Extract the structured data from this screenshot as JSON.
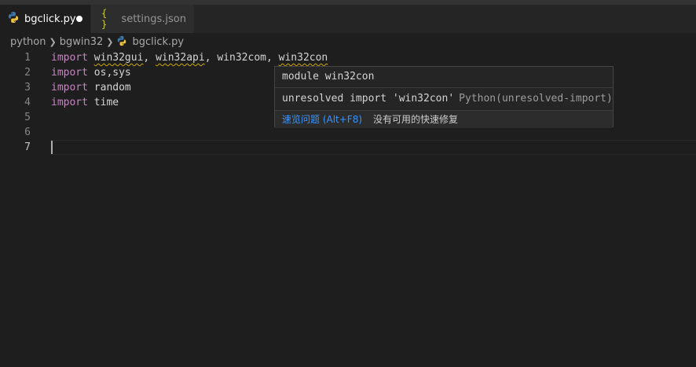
{
  "tabs": [
    {
      "label": "bgclick.py",
      "icon": "python-icon",
      "active": true,
      "dirty": true
    },
    {
      "label": "settings.json",
      "icon": "json-braces-icon",
      "active": false,
      "dirty": false
    }
  ],
  "json_icon_glyph": "{ }",
  "breadcrumb": {
    "items": [
      "python",
      "bgwin32",
      "bgclick.py"
    ]
  },
  "editor": {
    "lines": [
      {
        "number": "1",
        "keyword": "import",
        "rest": "win32gui, win32api, win32com, win32con"
      },
      {
        "number": "2",
        "keyword": "import",
        "rest": "os,sys"
      },
      {
        "number": "3",
        "keyword": "import",
        "rest": "random"
      },
      {
        "number": "4",
        "keyword": "import",
        "rest": "time"
      },
      {
        "number": "5",
        "keyword": "",
        "rest": ""
      },
      {
        "number": "6",
        "keyword": "",
        "rest": ""
      },
      {
        "number": "7",
        "keyword": "",
        "rest": ""
      }
    ],
    "line1_parts": {
      "p1": "win32gui",
      "c1": ", ",
      "p2": "win32api",
      "c2": ", ",
      "p3": "win32com",
      "c3": ", ",
      "p4": "win32con"
    },
    "current_line": "7"
  },
  "hover": {
    "title": "module win32con",
    "message": "unresolved import 'win32con'",
    "source": "Python(unresolved-import)",
    "quick_fix_link": "速览问题 (Alt+F8)",
    "no_fix_text": "没有可用的快速修复"
  },
  "colors": {
    "keyword": "#c586c0",
    "squiggle": "#cca700",
    "link": "#3794ff",
    "background": "#1e1e1e"
  }
}
